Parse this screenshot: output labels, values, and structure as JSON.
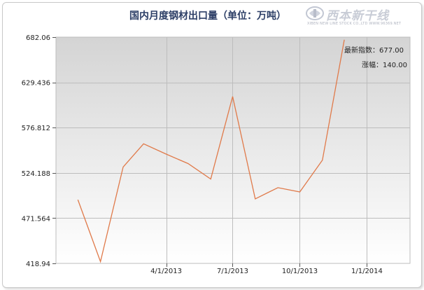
{
  "chart_data": {
    "type": "line",
    "title": "国内月度钢材出口量（单位：万吨）",
    "x": [
      "2012-12",
      "2013-01",
      "2013-02",
      "2013-03",
      "2013-04",
      "2013-05",
      "2013-06",
      "2013-07",
      "2013-08",
      "2013-09",
      "2013-10",
      "2013-11",
      "2013-12",
      "2014-01",
      "2014-02"
    ],
    "series": [
      {
        "values": [
          493,
          421,
          531,
          558,
          546,
          535,
          517,
          613,
          494,
          507,
          502,
          539,
          679
        ]
      }
    ],
    "x_values": [
      "2012-12",
      "2013-01",
      "2013-02",
      "2013-03",
      "2013-04",
      "2013-05",
      "2013-06",
      "2013-07",
      "2013-08",
      "2013-09",
      "2013-10",
      "2013-11",
      "2013-12"
    ],
    "x_tick_labels": [
      "4/1/2013",
      "7/1/2013",
      "10/1/2013",
      "1/1/2014"
    ],
    "x_tick_dates": [
      "2013-04-01",
      "2013-07-01",
      "2013-10-01",
      "2014-01-01"
    ],
    "y_tick_labels": [
      "682.06",
      "629.436",
      "576.812",
      "524.188",
      "471.564",
      "418.94"
    ],
    "ylim": [
      418.94,
      682.06
    ],
    "xlim": [
      "2012-11-01",
      "2014-03-01"
    ],
    "grid": true,
    "line_color": "#e07a4a",
    "plot_bg_top": "#d4d4d4",
    "plot_bg_bottom": "#ffffff"
  },
  "info": {
    "latest_label": "最新指数：",
    "latest_value": "677.00",
    "change_label": "涨幅：",
    "change_value": "140.00"
  },
  "logo": {
    "name": "西本新干线",
    "subtitle": "XIBEN NEW LINE STOCK CO.,LTD   WWW.96369.NET"
  }
}
